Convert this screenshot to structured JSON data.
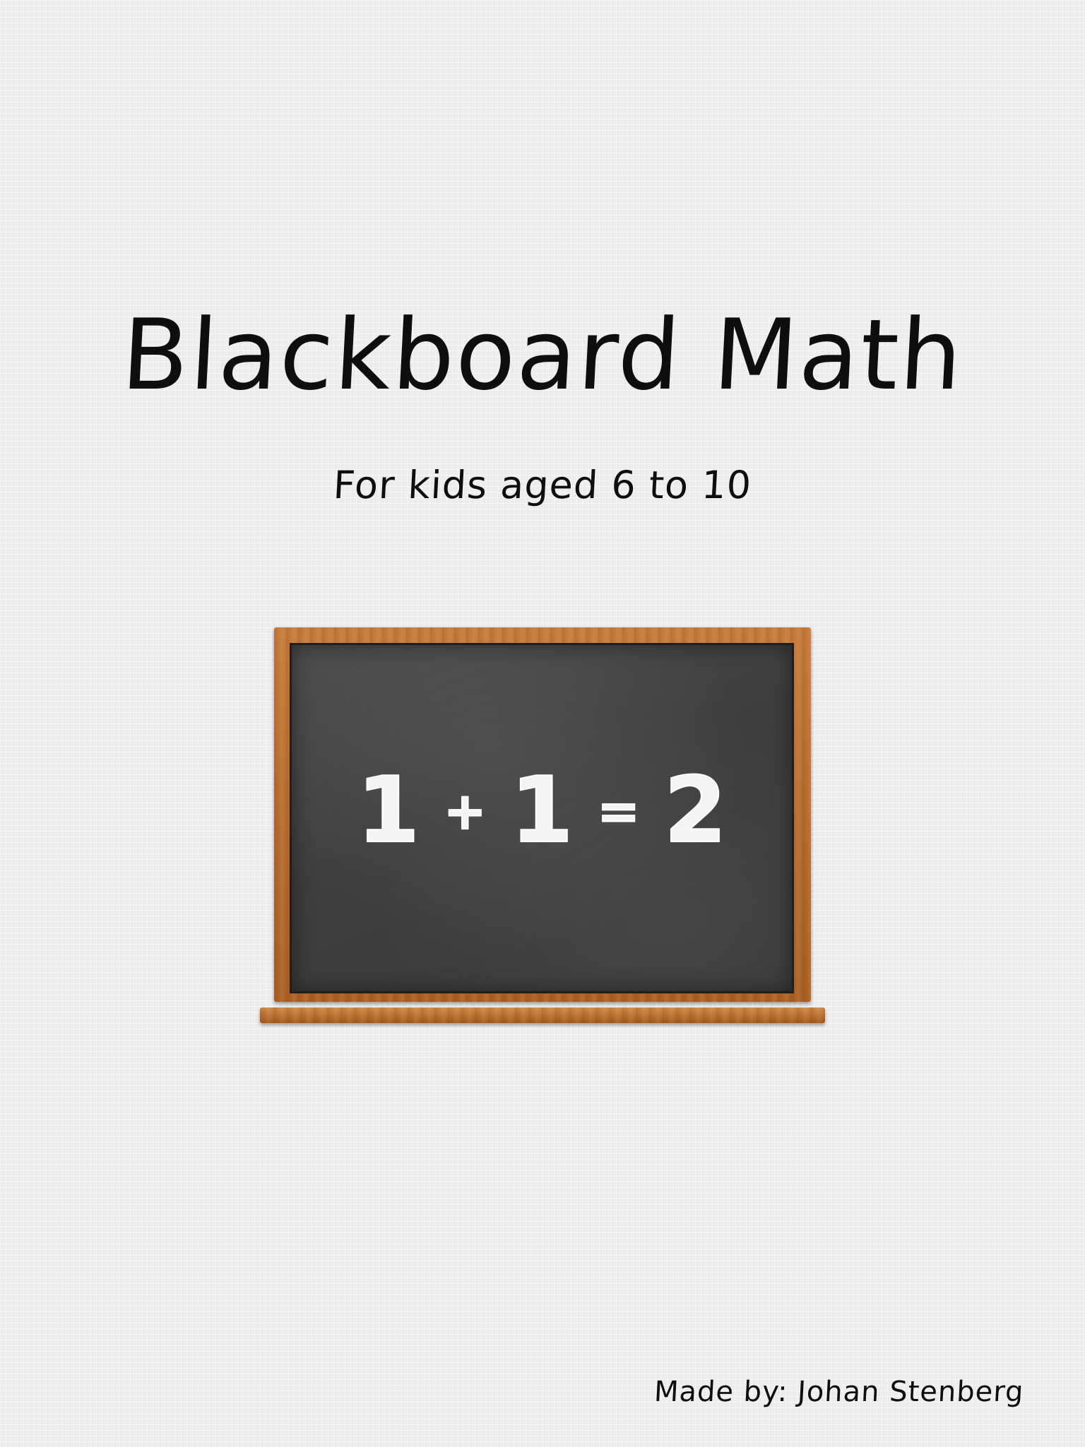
{
  "page": {
    "title": "Blackboard Math",
    "subtitle": "For kids aged 6 to 10",
    "credit": "Made by: Johan Stenberg"
  },
  "blackboard": {
    "equation": {
      "operand_a": "1",
      "operator_plus": "+",
      "operand_b": "1",
      "operator_equals": "=",
      "result": "2"
    }
  },
  "colors": {
    "background": "#ececec",
    "text": "#0e0e0e",
    "board": "#3e3e3e",
    "frame": "#b56b2c",
    "chalk": "#f4f4f4"
  }
}
